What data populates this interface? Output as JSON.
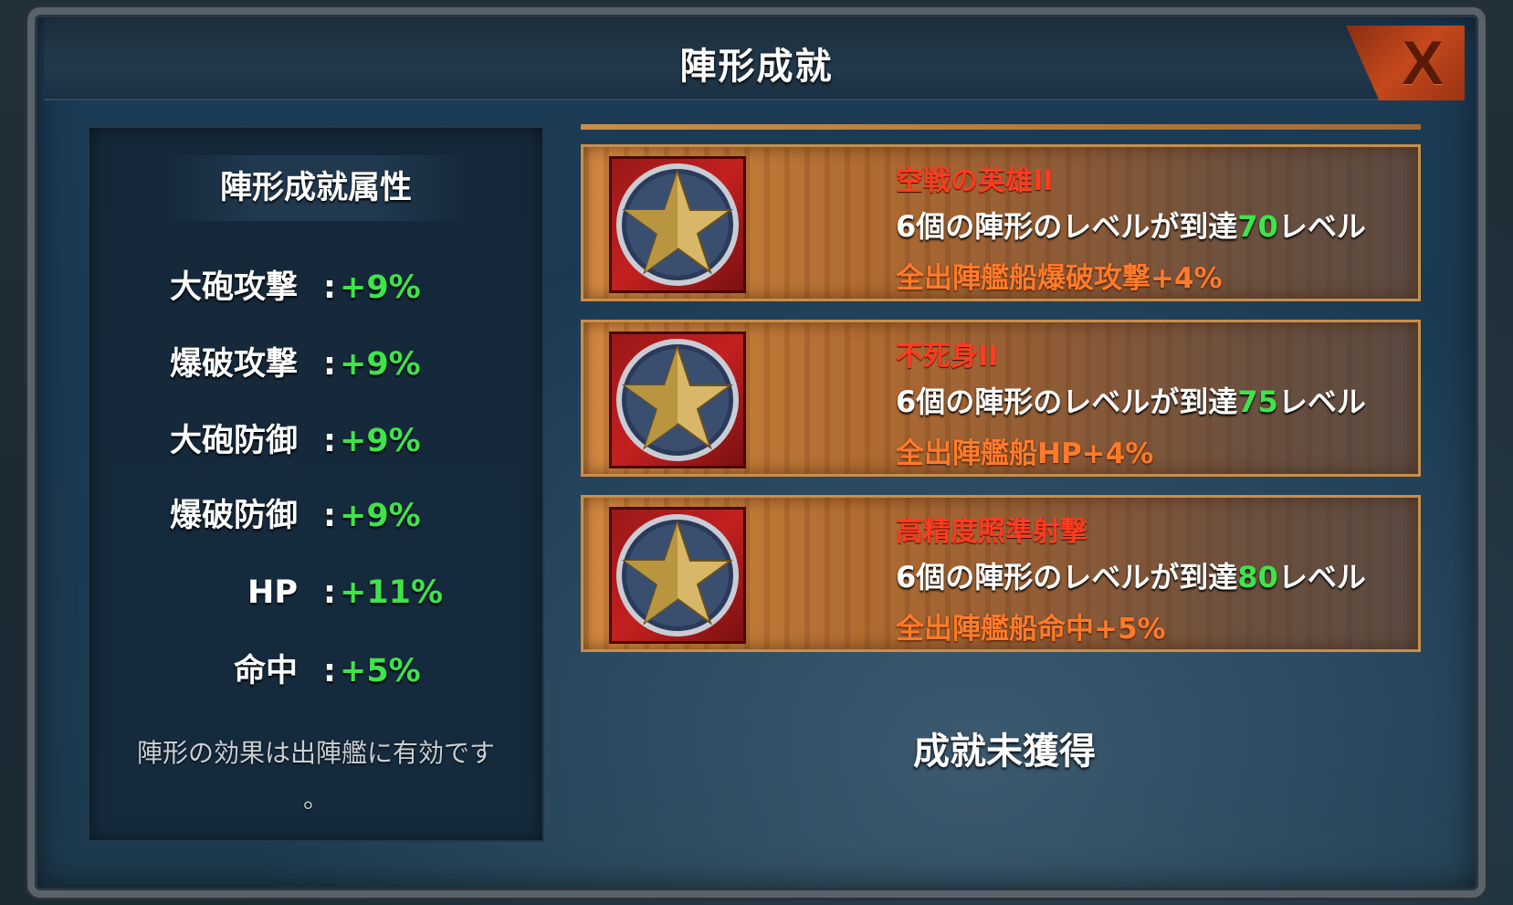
{
  "window": {
    "title": "陣形成就",
    "close_label": "X"
  },
  "attributes_panel": {
    "heading": "陣形成就属性",
    "stats": [
      {
        "label": "大砲攻撃",
        "value": "+9%"
      },
      {
        "label": "爆破攻撃",
        "value": "+9%"
      },
      {
        "label": "大砲防御",
        "value": "+9%"
      },
      {
        "label": "爆破防御",
        "value": "+9%"
      },
      {
        "label": "HP",
        "value": "+11%"
      },
      {
        "label": "命中",
        "value": "+5%"
      }
    ],
    "colon": ":",
    "note_line1": "陣形の効果は出陣艦に有効です",
    "note_line2": "。"
  },
  "achievements": [
    {
      "name": "空戦の英雄II",
      "condition_prefix": "6個の陣形のレベルが到達",
      "condition_level": "70",
      "condition_suffix": "レベル",
      "reward": "全出陣艦船爆破攻撃+4%"
    },
    {
      "name": "不死身II",
      "condition_prefix": "6個の陣形のレベルが到達",
      "condition_level": "75",
      "condition_suffix": "レベル",
      "reward": "全出陣艦船HP+4%"
    },
    {
      "name": "高精度照準射撃",
      "condition_prefix": "6個の陣形のレベルが到達",
      "condition_level": "80",
      "condition_suffix": "レベル",
      "reward": "全出陣艦船命中+5%"
    }
  ],
  "status": {
    "text": "成就未獲得"
  },
  "colors": {
    "value_green": "#3fe34a",
    "name_red": "#ff3b20",
    "reward_orange": "#ff7a2a"
  }
}
